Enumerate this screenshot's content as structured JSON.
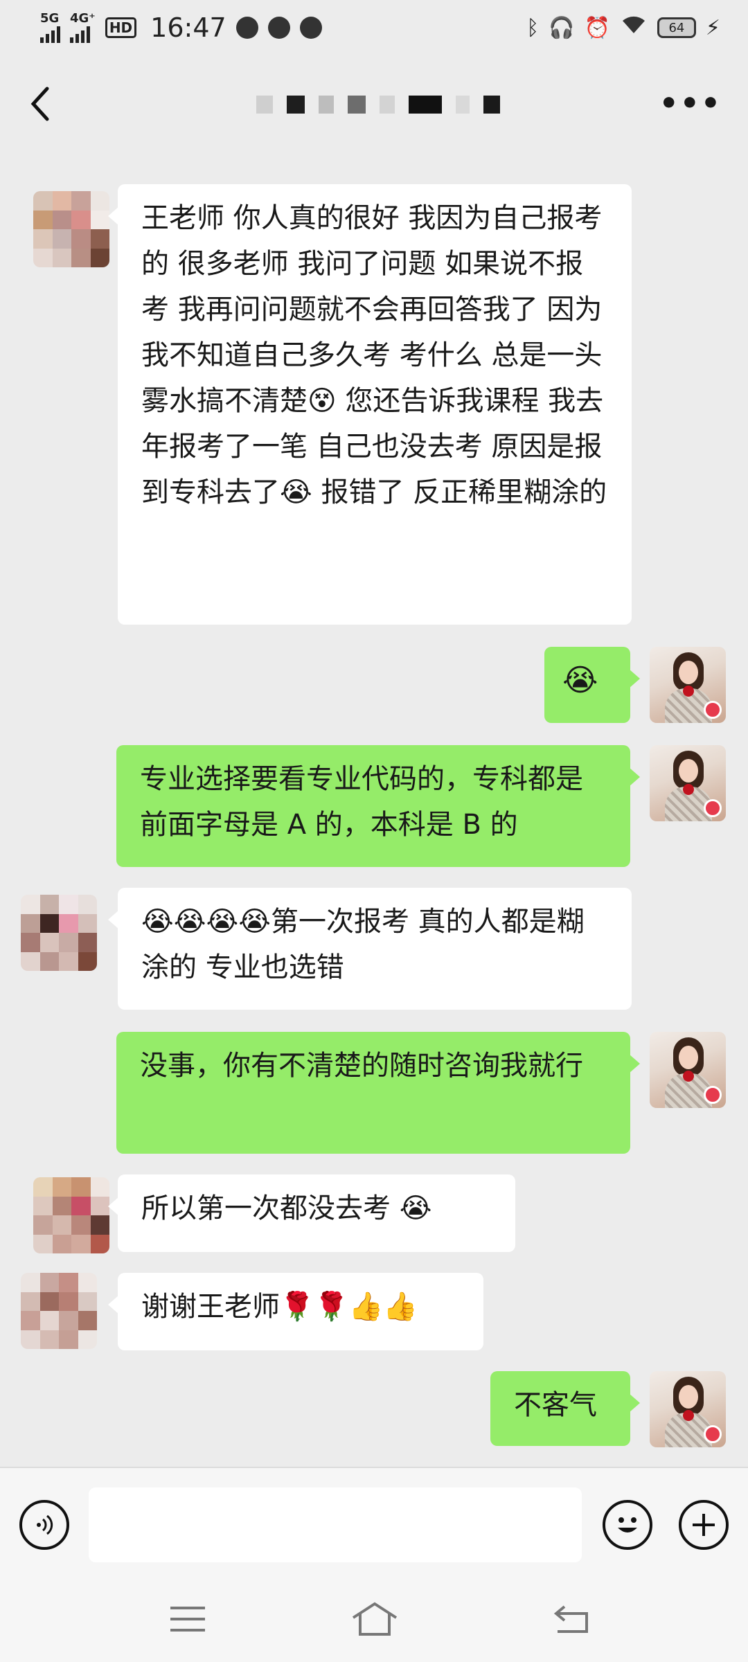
{
  "status_bar": {
    "network_1": "5G",
    "network_2": "4G⁺",
    "hd": "HD",
    "hd_sub": "2",
    "time": "16:47",
    "battery": "64"
  },
  "header": {
    "title": "",
    "back_icon": "chevron-left-icon",
    "more_icon": "more-dots-icon"
  },
  "messages": [
    {
      "side": "left",
      "text": "王老师  你人真的很好   我因为自己报考的    很多老师  我问了问题  如果说不报考  我再问问题就不会再回答我了  因为我不知道自己多久考  考什么   总是一头雾水搞不清楚😵  您还告诉我课程   我去年报考了一笔   自己也没去考   原因是报到专科去了😭   报错了  反正稀里糊涂的"
    },
    {
      "side": "right",
      "text": "😭"
    },
    {
      "side": "right",
      "text": "专业选择要看专业代码的，专科都是前面字母是 A 的，本科是 B 的"
    },
    {
      "side": "left",
      "text": "😭😭😭😭第一次报考  真的人都是糊涂的  专业也选错"
    },
    {
      "side": "right",
      "text": "没事，你有不清楚的随时咨询我就行"
    },
    {
      "side": "left",
      "text": "所以第一次都没去考    😭"
    },
    {
      "side": "left",
      "text": "谢谢王老师🌹🌹👍👍"
    },
    {
      "side": "right",
      "text": "不客气"
    }
  ],
  "input_bar": {
    "voice_icon": "voice-icon",
    "input_placeholder": "",
    "emoji_icon": "smile-icon",
    "plus_icon": "plus-icon"
  },
  "nav_bar": {
    "menu_icon": "menu-icon",
    "home_icon": "home-icon",
    "back_icon": "back-icon"
  },
  "colors": {
    "background": "#ececec",
    "bubble_self": "#95ec69",
    "bubble_other": "#ffffff"
  }
}
